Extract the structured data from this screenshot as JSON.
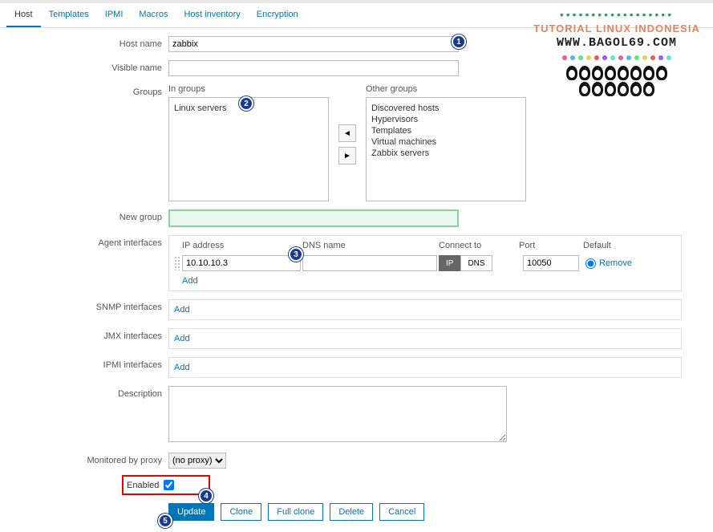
{
  "tabs": {
    "host": "Host",
    "templates": "Templates",
    "ipmi": "IPMI",
    "macros": "Macros",
    "inventory": "Host inventory",
    "encryption": "Encryption"
  },
  "labels": {
    "hostname": "Host name",
    "visiblename": "Visible name",
    "groups": "Groups",
    "ingroups": "In groups",
    "othergroups": "Other groups",
    "newgroup": "New group",
    "agentif": "Agent interfaces",
    "ipaddr": "IP address",
    "dnsname": "DNS name",
    "connectto": "Connect to",
    "port": "Port",
    "default": "Default",
    "remove": "Remove",
    "add": "Add",
    "snmp": "SNMP interfaces",
    "jmx": "JMX interfaces",
    "ipmiif": "IPMI interfaces",
    "description": "Description",
    "proxy": "Monitored by proxy",
    "enabled": "Enabled"
  },
  "values": {
    "hostname": "zabbix",
    "visiblename": "",
    "ingroup": "Linux servers",
    "og1": "Discovered hosts",
    "og2": "Hypervisors",
    "og3": "Templates",
    "og4": "Virtual machines",
    "og5": "Zabbix servers",
    "ip": "10.10.10.3",
    "dns": "",
    "cIP": "IP",
    "cDNS": "DNS",
    "port": "10050",
    "proxy": "(no proxy)",
    "desc": ""
  },
  "buttons": {
    "update": "Update",
    "clone": "Clone",
    "fullclone": "Full clone",
    "delete": "Delete",
    "cancel": "Cancel"
  },
  "callouts": {
    "c1": "1",
    "c2": "2",
    "c3": "3",
    "c4": "4",
    "c5": "5"
  },
  "watermark": {
    "title": "TUTORIAL LINUX INDONESIA",
    "url": "WWW.BAGOL69.COM"
  }
}
